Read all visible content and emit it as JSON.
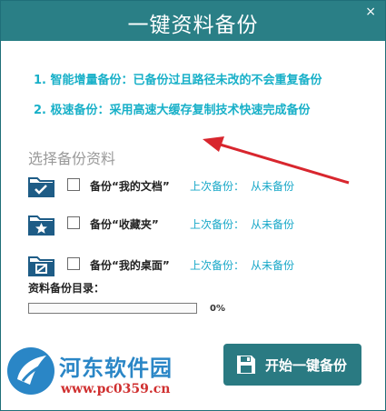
{
  "window": {
    "title": "一键资料备份",
    "close_glyph": "×"
  },
  "tips": [
    "1. 智能增量备份：已备份过且路径未改的不会重复备份",
    "2. 极速备份：采用高速大缓存复制技术快速完成备份"
  ],
  "section_title": "选择备份资料",
  "items": [
    {
      "label": "备份“我的文档”",
      "last_label": "上次备份：",
      "last_value": "从未备份",
      "icon": "folder-check-icon"
    },
    {
      "label": "备份“收藏夹”",
      "last_label": "上次备份：",
      "last_value": "从未备份",
      "icon": "folder-star-icon"
    },
    {
      "label": "备份“我的桌面”",
      "last_label": "上次备份：",
      "last_value": "从未备份",
      "icon": "folder-desktop-icon"
    }
  ],
  "backup_dir_label": "资料备份目录：",
  "progress": {
    "value": 0,
    "text": "0%"
  },
  "watermark": {
    "name": "河东软件园",
    "url": "www.pc0359.cn"
  },
  "start_button": {
    "label": "开始一键备份",
    "icon": "save-icon"
  },
  "colors": {
    "accent": "#2a7f86",
    "tip": "#18b0c8",
    "arrow": "#d8262e"
  }
}
